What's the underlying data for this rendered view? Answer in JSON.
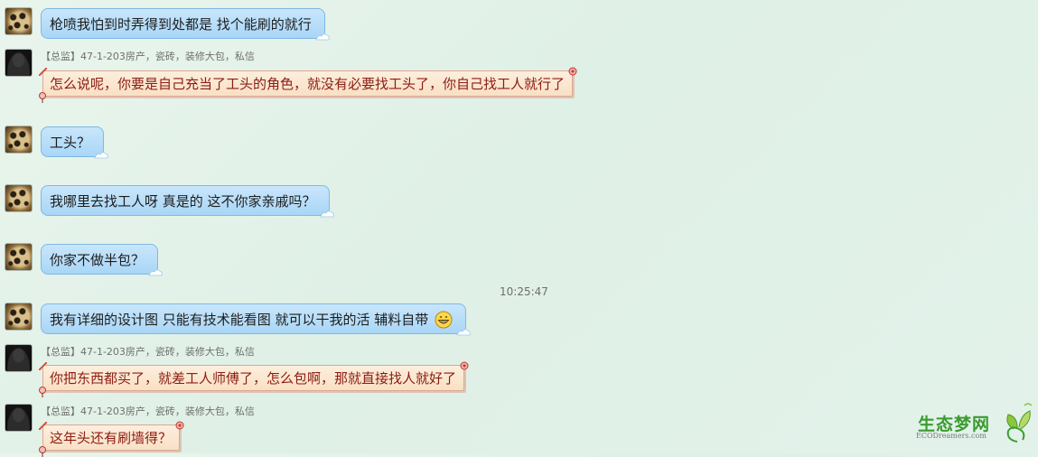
{
  "messages": [
    {
      "type": "self",
      "text": "枪喷我怕到时弄得到处都是  找个能刷的就行"
    },
    {
      "type": "other",
      "meta": "【总监】47-1-203房产，瓷砖，装修大包，私信",
      "text": "怎么说呢，你要是自己充当了工头的角色，就没有必要找工头了，你自己找工人就行了"
    },
    {
      "type": "self",
      "text": "工头？"
    },
    {
      "type": "self",
      "text": "我哪里去找工人呀 真是的 这不你家亲戚吗？"
    },
    {
      "type": "self",
      "text": "你家不做半包？"
    },
    {
      "type": "self",
      "text": "我有详细的设计图 只能有技术能看图 就可以干我的活 辅料自带"
    },
    {
      "type": "other",
      "meta": "【总监】47-1-203房产，瓷砖，装修大包，私信",
      "text": "你把东西都买了，就差工人师傅了，怎么包啊，那就直接找人就好了"
    },
    {
      "type": "other",
      "meta": "【总监】47-1-203房产，瓷砖，装修大包，私信",
      "text": "这年头还有刷墙得？"
    }
  ],
  "timestamp": "10:25:47",
  "watermark": {
    "title": "生态梦网",
    "subtitle": "ECODreamers.com"
  },
  "colors": {
    "self_bubble": "#b7ddf9",
    "other_bubble": "#fbe6cf",
    "other_text": "#8b1c12",
    "logo": "#3a9c2e"
  }
}
